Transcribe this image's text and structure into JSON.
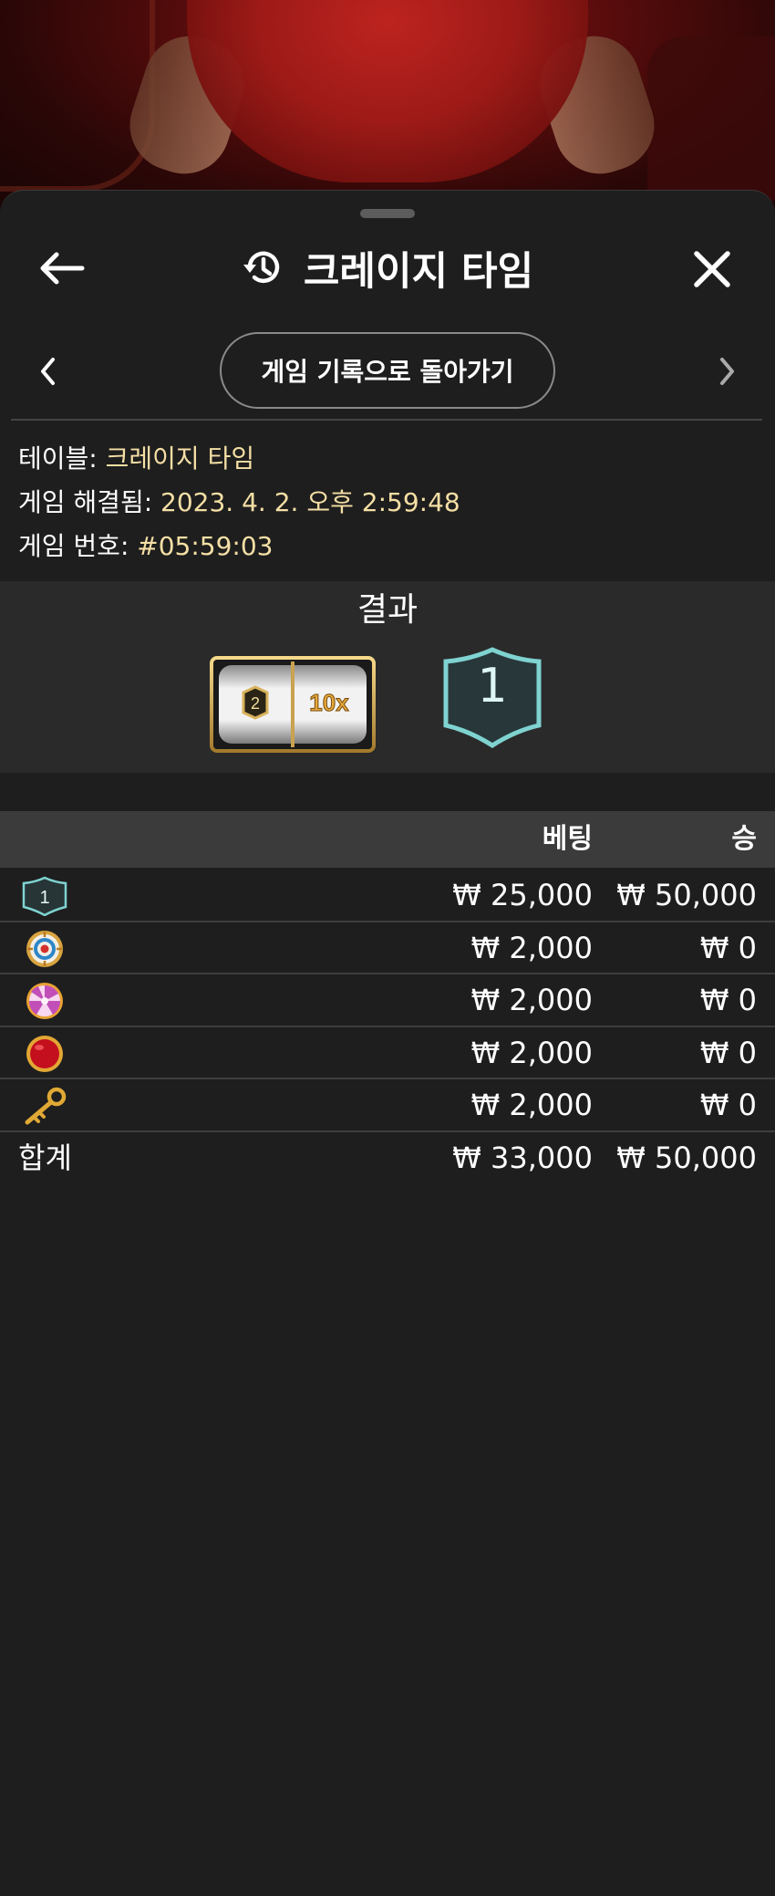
{
  "header": {
    "title": "크레이지 타임"
  },
  "nav": {
    "back_to_history_label": "게임 기록으로 돌아가기"
  },
  "info": {
    "table_label": "테이블: ",
    "table_value": "크레이지 타임",
    "resolved_label": "게임 해결됨: ",
    "resolved_value": "2023. 4. 2. 오후 2:59:48",
    "game_no_label": "게임 번호: ",
    "game_no_value": "#05:59:03"
  },
  "result": {
    "label": "결과",
    "slot_number": "2",
    "slot_multiplier": "10x",
    "outcome": "1"
  },
  "bets_table": {
    "bet_header": "베팅",
    "win_header": "승",
    "rows": [
      {
        "icon": "number-one-shield-icon",
        "icon_text": "1",
        "bet": "₩ 25,000",
        "win": "₩ 50,000"
      },
      {
        "icon": "coin-flip-target-icon",
        "bet": "₩ 2,000",
        "win": "₩ 0"
      },
      {
        "icon": "pachinko-candy-icon",
        "bet": "₩ 2,000",
        "win": "₩ 0"
      },
      {
        "icon": "red-ball-icon",
        "bet": "₩ 2,000",
        "win": "₩ 0"
      },
      {
        "icon": "golden-key-icon",
        "bet": "₩ 2,000",
        "win": "₩ 0"
      }
    ],
    "total_label": "합계",
    "total_bet": "₩ 33,000",
    "total_win": "₩ 50,000"
  },
  "colors": {
    "sheet_bg": "#1e1e1e",
    "info_value": "#f5dfa5",
    "shield_teal": "#7fd3d1",
    "gold": "#d8b25c"
  }
}
